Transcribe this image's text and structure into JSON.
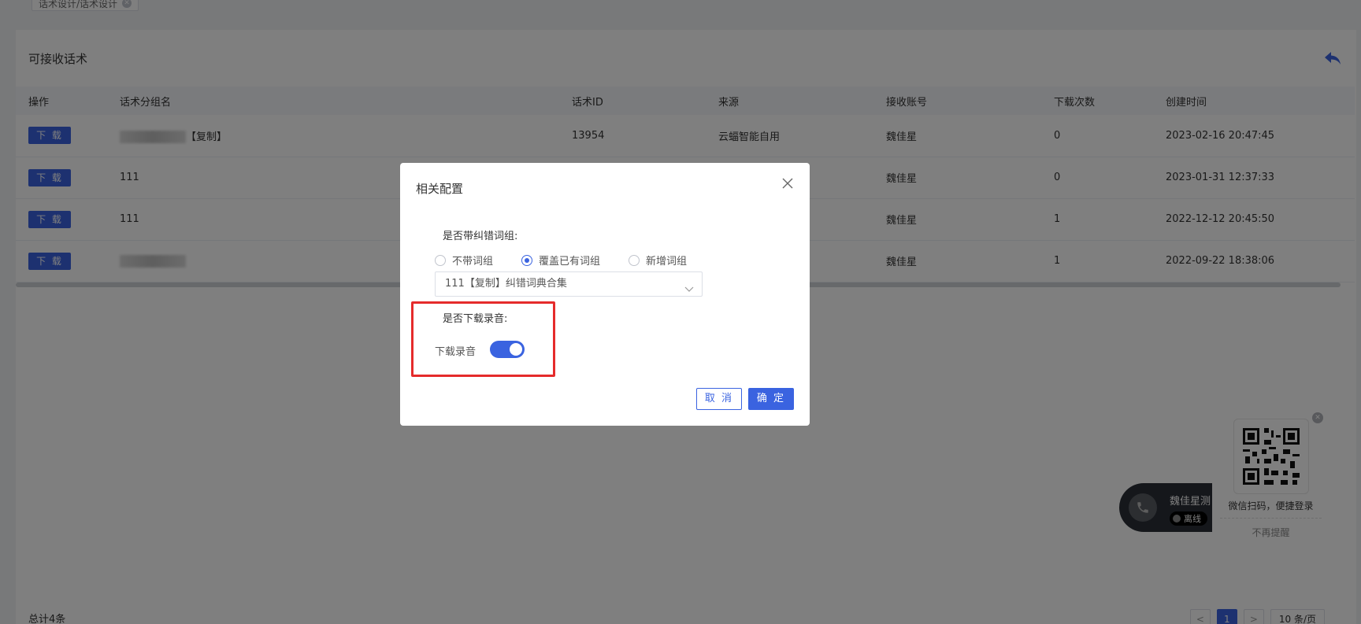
{
  "tab": {
    "label": "话术设计/话术设计"
  },
  "page": {
    "title": "可接收话术"
  },
  "table": {
    "columns": [
      "操作",
      "话术分组名",
      "话术ID",
      "来源",
      "接收账号",
      "下载次数",
      "创建时间"
    ],
    "download_label": "下 载",
    "rows": [
      {
        "name": "【复制】",
        "id": "13954",
        "source": "云蝠智能自用",
        "account": "魏佳星",
        "count": "0",
        "created": "2023-02-16 20:47:45"
      },
      {
        "name": "111",
        "id": "",
        "source": "",
        "account": "魏佳星",
        "count": "0",
        "created": "2023-01-31 12:37:33"
      },
      {
        "name": "111",
        "id": "",
        "source": "",
        "account": "魏佳星",
        "count": "1",
        "created": "2022-12-12 20:45:50"
      },
      {
        "name": "",
        "id": "",
        "source": "",
        "account": "魏佳星",
        "count": "1",
        "created": "2022-09-22 18:38:06"
      }
    ]
  },
  "footer": {
    "total": "总计4条",
    "current_page": "1",
    "page_size": "10 条/页"
  },
  "softphone": {
    "name": "魏佳星测",
    "status": "离线"
  },
  "qr_popup": {
    "text": "微信扫码，便捷登录",
    "dismiss": "不再提醒"
  },
  "dialog": {
    "title": "相关配置",
    "section1_label": "是否带纠错词组:",
    "radio_options": [
      "不带词组",
      "覆盖已有词组",
      "新增词组"
    ],
    "selected_option": "覆盖已有词组",
    "select_value": "111【复制】纠错词典合集",
    "section2_label": "是否下载录音:",
    "switch_label": "下载录音",
    "switch_on": true,
    "cancel_label": "取 消",
    "ok_label": "确 定"
  },
  "colors": {
    "primary": "#3a63e0",
    "highlight": "#e52b2b"
  }
}
